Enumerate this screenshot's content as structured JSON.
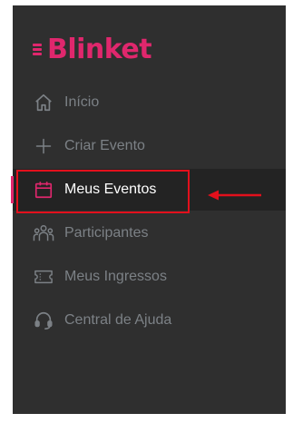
{
  "brand": {
    "name": "Blinket",
    "color": "#e0276d"
  },
  "sidebar": {
    "items": [
      {
        "label": "Início",
        "icon": "home-icon",
        "active": false
      },
      {
        "label": "Criar Evento",
        "icon": "plus-icon",
        "active": false
      },
      {
        "label": "Meus Eventos",
        "icon": "calendar-icon",
        "active": true
      },
      {
        "label": "Participantes",
        "icon": "people-icon",
        "active": false
      },
      {
        "label": "Meus Ingressos",
        "icon": "ticket-icon",
        "active": false
      },
      {
        "label": "Central de Ajuda",
        "icon": "headset-icon",
        "active": false
      }
    ]
  },
  "annotation": {
    "box_color": "#e3101c",
    "arrow_color": "#e3101c"
  },
  "colors": {
    "sidebar_bg": "#2f2f2f",
    "active_bg": "#232323",
    "inactive_text": "#7c8186",
    "active_text": "#ffffff"
  }
}
